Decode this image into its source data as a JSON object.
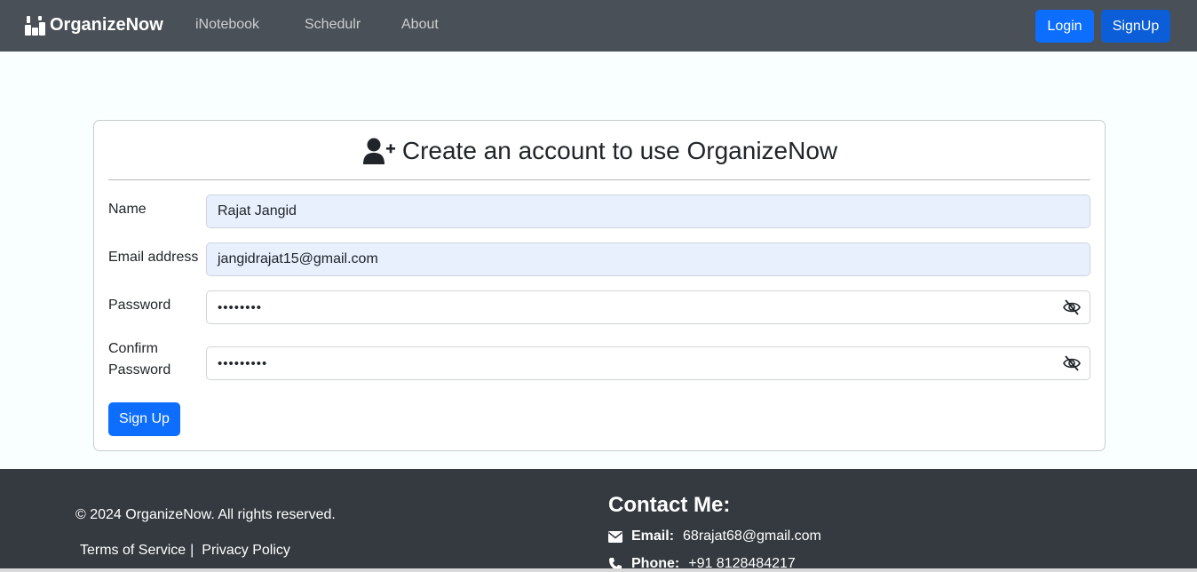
{
  "navbar": {
    "brand": "OrganizeNow",
    "links": [
      "iNotebook",
      "Schedulr",
      "About"
    ],
    "login_label": "Login",
    "signup_label": "SignUp"
  },
  "form": {
    "title": "Create an account to use OrganizeNow",
    "name_label": "Name",
    "name_value": "Rajat Jangid",
    "email_label": "Email address",
    "email_value": "jangidrajat15@gmail.com",
    "password_label": "Password",
    "password_value": "••••••••",
    "confirm_label_line1": "Confirm",
    "confirm_label_line2": "Password",
    "confirm_value": "•••••••••",
    "submit_label": "Sign Up"
  },
  "footer": {
    "copyright": "© 2024 OrganizeNow. All rights reserved.",
    "terms": "Terms of Service",
    "separator": "|",
    "privacy": "Privacy Policy",
    "contact_title": "Contact Me:",
    "email_label": "Email:",
    "email_value": "68rajat68@gmail.com",
    "phone_label": "Phone:",
    "phone_value": "+91 8128484217"
  },
  "colors": {
    "navbar_bg": "#495057",
    "primary": "#0d6efd",
    "footer_bg": "#343a40",
    "autofill_bg": "#e8f0fe"
  },
  "icons": [
    "brand-logo-icon",
    "user-plus-icon",
    "eye-slash-icon",
    "envelope-icon",
    "phone-icon"
  ]
}
